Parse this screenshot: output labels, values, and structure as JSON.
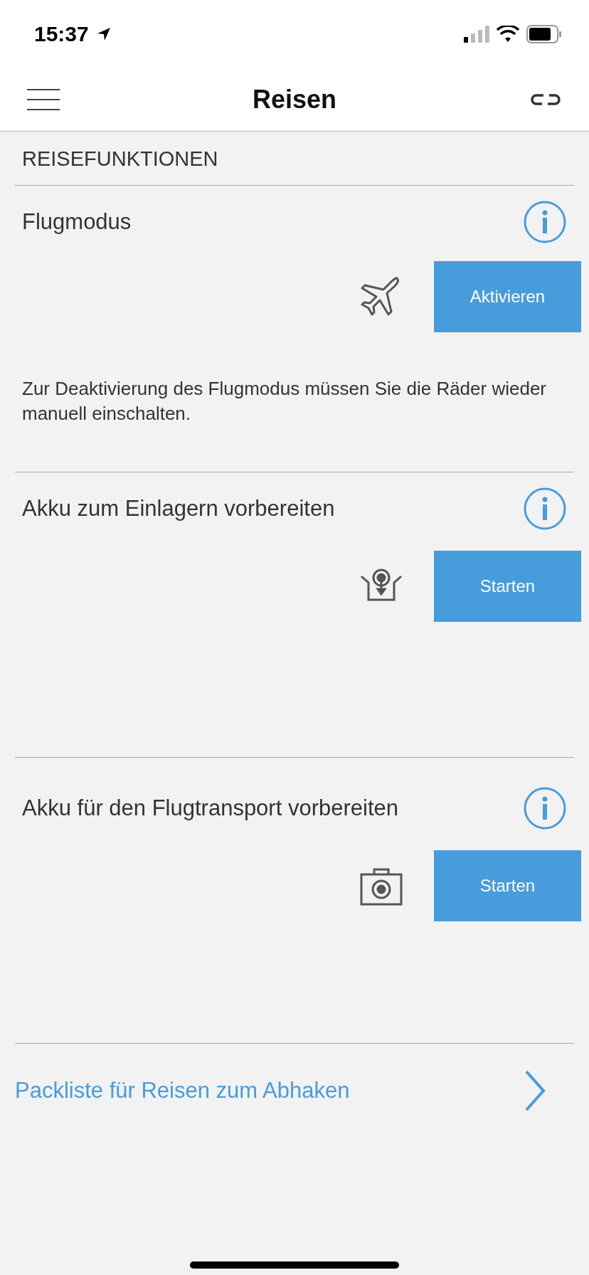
{
  "status_bar": {
    "time": "15:37"
  },
  "nav_bar": {
    "title": "Reisen"
  },
  "section_header": "REISEFUNKTIONEN",
  "functions": [
    {
      "kind": "plane",
      "title": "Flugmodus",
      "button": "Aktivieren",
      "note": "Zur Deaktivierung des Flugmodus müssen Sie die Räder wieder manuell einschalten."
    },
    {
      "kind": "storage",
      "title": "Akku zum Einlagern vorbereiten",
      "button": "Starten"
    },
    {
      "kind": "case",
      "title": "Akku für den Flugtransport vorbereiten",
      "button": "Starten"
    }
  ],
  "link": {
    "label": "Packliste für Reisen zum Abhaken"
  }
}
